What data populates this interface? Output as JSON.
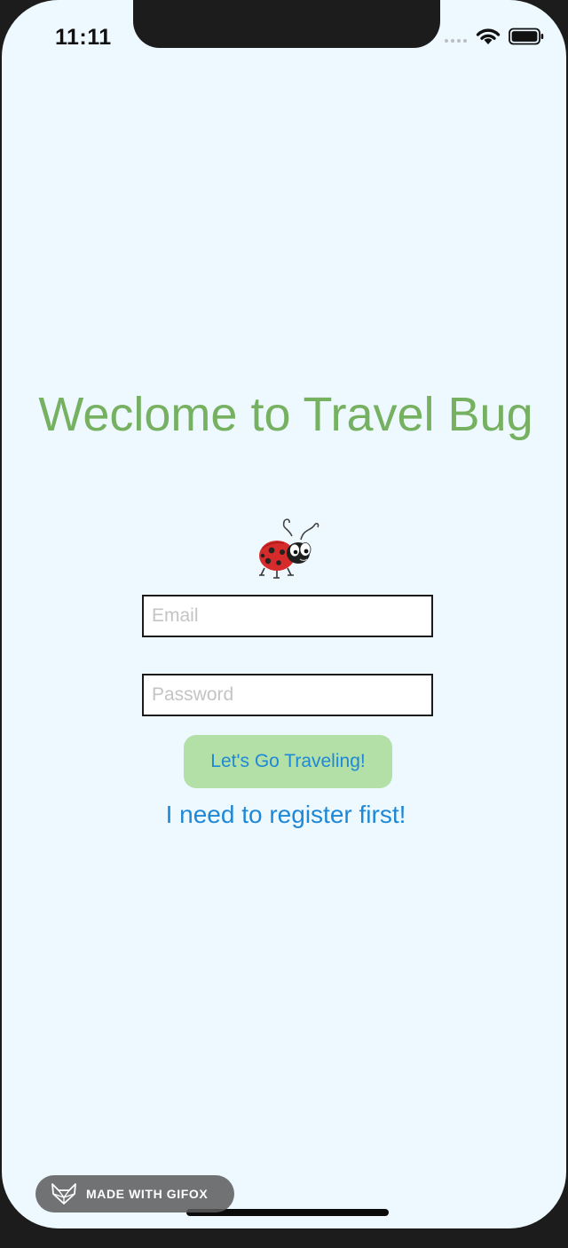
{
  "status_bar": {
    "time": "11:11",
    "icons": [
      "cellular-signal-icon",
      "wifi-icon",
      "battery-icon"
    ]
  },
  "login": {
    "title": "Weclome to Travel Bug",
    "logo_icon": "ladybug-icon",
    "email_placeholder": "Email",
    "email_value": "",
    "password_placeholder": "Password",
    "password_value": "",
    "submit_label": "Let's Go Traveling!",
    "register_label": "I need to register first!"
  },
  "watermark": {
    "label": "MADE WITH GIFOX",
    "icon": "fox-icon"
  },
  "colors": {
    "background": "#eef9ff",
    "title": "#76b061",
    "button_bg": "#b3e0a7",
    "link": "#1f88d6"
  }
}
